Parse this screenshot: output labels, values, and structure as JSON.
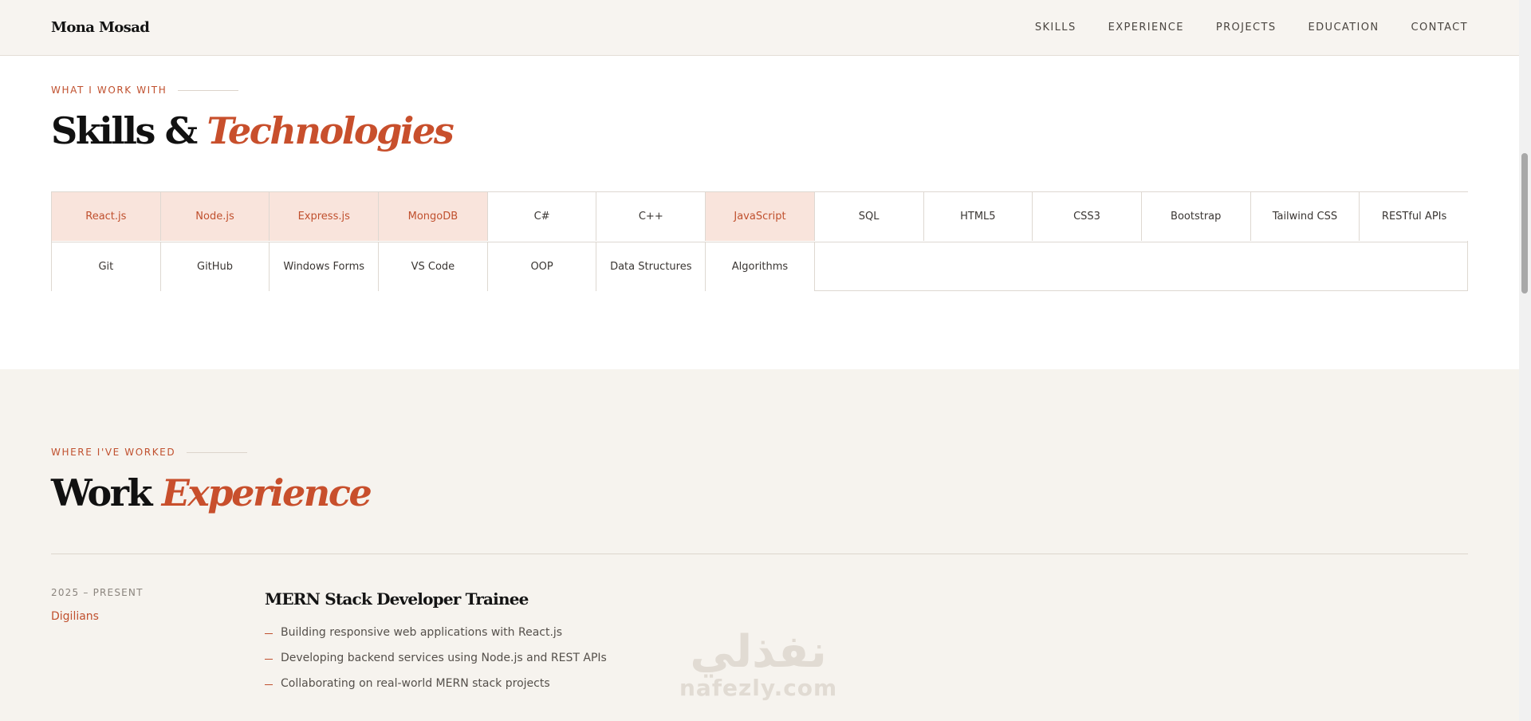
{
  "header": {
    "brand": "Mona Mosad",
    "nav": [
      {
        "label": "SKILLS"
      },
      {
        "label": "EXPERIENCE"
      },
      {
        "label": "PROJECTS"
      },
      {
        "label": "EDUCATION"
      },
      {
        "label": "CONTACT"
      }
    ]
  },
  "skills": {
    "eyebrow": "WHAT I WORK WITH",
    "title_main": "Skills & ",
    "title_accent": "Technologies",
    "items": [
      {
        "label": "React.js",
        "highlight": true
      },
      {
        "label": "Node.js",
        "highlight": true
      },
      {
        "label": "Express.js",
        "highlight": true
      },
      {
        "label": "MongoDB",
        "highlight": true
      },
      {
        "label": "C#",
        "highlight": false
      },
      {
        "label": "C++",
        "highlight": false
      },
      {
        "label": "JavaScript",
        "highlight": true
      },
      {
        "label": "SQL",
        "highlight": false
      },
      {
        "label": "HTML5",
        "highlight": false
      },
      {
        "label": "CSS3",
        "highlight": false
      },
      {
        "label": "Bootstrap",
        "highlight": false
      },
      {
        "label": "Tailwind CSS",
        "highlight": false
      },
      {
        "label": "RESTful APIs",
        "highlight": false
      },
      {
        "label": "Git",
        "highlight": false
      },
      {
        "label": "GitHub",
        "highlight": false
      },
      {
        "label": "Windows Forms",
        "highlight": false
      },
      {
        "label": "VS Code",
        "highlight": false
      },
      {
        "label": "OOP",
        "highlight": false
      },
      {
        "label": "Data Structures",
        "highlight": false
      },
      {
        "label": "Algorithms",
        "highlight": false
      }
    ]
  },
  "experience": {
    "eyebrow": "WHERE I'VE WORKED",
    "title_main": "Work ",
    "title_accent": "Experience",
    "jobs": [
      {
        "period": "2025 – PRESENT",
        "company": "Digilians",
        "role": "MERN Stack Developer Trainee",
        "bullets": [
          "Building responsive web applications with React.js",
          "Developing backend services using Node.js and REST APIs",
          "Collaborating on real-world MERN stack projects"
        ]
      }
    ]
  },
  "watermark": {
    "arabic": "نفذلي",
    "latin": "nafezly.com"
  },
  "colors": {
    "accent": "#c84f2c",
    "highlight_bg": "#f9e4dc",
    "section_bg": "#f6f3ee",
    "header_bg": "#f7f4f0"
  }
}
